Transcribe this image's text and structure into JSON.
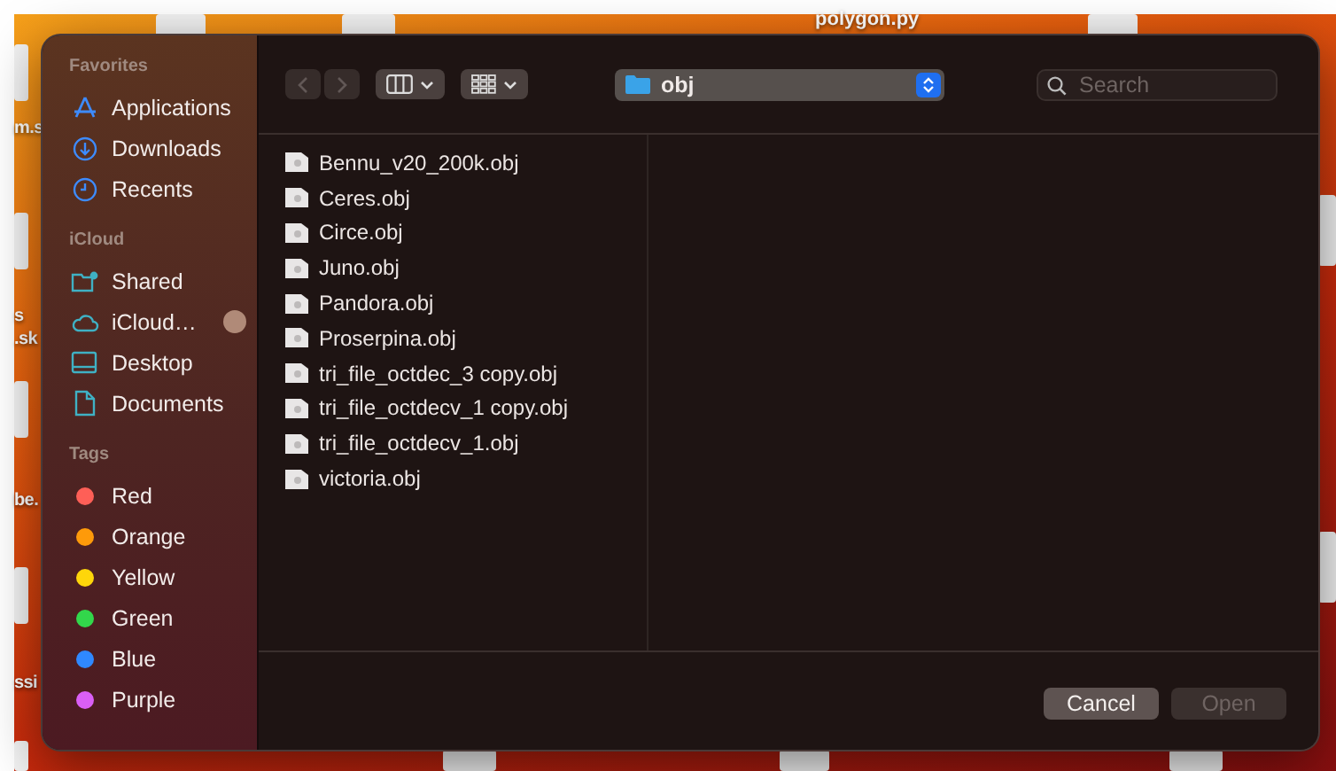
{
  "desktop": {
    "labels": [
      {
        "text": "polygon.py"
      },
      {
        "text": "m.s"
      },
      {
        "text": "s"
      },
      {
        "text": ".sk"
      },
      {
        "text": "be."
      },
      {
        "text": "ssi"
      }
    ]
  },
  "dialog": {
    "navigation": {
      "back_enabled": false,
      "forward_enabled": false
    },
    "location": "obj",
    "search": {
      "placeholder": "Search"
    },
    "sidebar": [
      {
        "title": "Favorites",
        "items": [
          {
            "label": "Applications",
            "kind": "applications"
          },
          {
            "label": "Downloads",
            "kind": "downloads"
          },
          {
            "label": "Recents",
            "kind": "recents"
          }
        ]
      },
      {
        "title": "iCloud",
        "items": [
          {
            "label": "Shared",
            "kind": "shared"
          },
          {
            "label": "iCloud…",
            "kind": "icloud"
          },
          {
            "label": "Desktop",
            "kind": "desktop"
          },
          {
            "label": "Documents",
            "kind": "documents"
          }
        ]
      },
      {
        "title": "Tags",
        "items": [
          {
            "label": "Red",
            "kind": "tag",
            "color": "#fe5f57"
          },
          {
            "label": "Orange",
            "kind": "tag",
            "color": "#fe9a0a"
          },
          {
            "label": "Yellow",
            "kind": "tag",
            "color": "#fed60a"
          },
          {
            "label": "Green",
            "kind": "tag",
            "color": "#32d74b"
          },
          {
            "label": "Blue",
            "kind": "tag",
            "color": "#2f88ff"
          },
          {
            "label": "Purple",
            "kind": "tag",
            "color": "#da5ff5"
          }
        ]
      }
    ],
    "files": [
      {
        "name": "Bennu_v20_200k.obj"
      },
      {
        "name": "Ceres.obj"
      },
      {
        "name": "Circe.obj"
      },
      {
        "name": "Juno.obj"
      },
      {
        "name": "Pandora.obj"
      },
      {
        "name": "Proserpina.obj"
      },
      {
        "name": "tri_file_octdec_3 copy.obj"
      },
      {
        "name": "tri_file_octdecv_1 copy.obj"
      },
      {
        "name": "tri_file_octdecv_1.obj"
      },
      {
        "name": "victoria.obj"
      }
    ],
    "buttons": [
      {
        "label": "Cancel",
        "disabled": false
      },
      {
        "label": "Open",
        "disabled": true
      }
    ]
  }
}
